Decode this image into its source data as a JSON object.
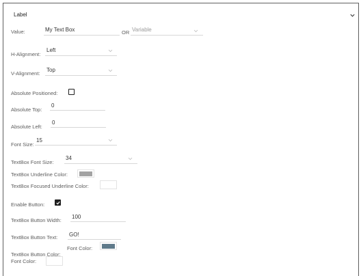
{
  "panel": {
    "title": "Label"
  },
  "value": {
    "label": "Value:",
    "text": "My Text Box",
    "or": "OR",
    "variable_placeholder": "Variable"
  },
  "h_alignment": {
    "label": "H-Alignment:",
    "value": "Left"
  },
  "v_alignment": {
    "label": "V-Alignment:",
    "value": "Top"
  },
  "absolute_positioned": {
    "label": "Absolute Positioned:",
    "checked": false
  },
  "absolute_top": {
    "label": "Absolute Top:",
    "value": "0"
  },
  "absolute_left": {
    "label": "Absolute Left:",
    "value": "0"
  },
  "font_size": {
    "label": "Font Size:",
    "value": "15"
  },
  "textbox_font_size": {
    "label": "TextBox Font Size:",
    "value": "34"
  },
  "textbox_underline_color": {
    "label": "TextBox Underline Color:",
    "color": "#a3a3a3"
  },
  "textbox_focused_underline_color": {
    "label": "TextBox Focused Underline Color:",
    "color": "#ffffff"
  },
  "enable_button": {
    "label": "Enable Button:",
    "checked": true
  },
  "textbox_button_width": {
    "label": "TextBox Button Width:",
    "value": "100"
  },
  "textbox_button_text": {
    "label": "TextBox Button Text:",
    "value": "GO!"
  },
  "button_font_color": {
    "label": "Font Color:",
    "color": "#5f7a8a"
  },
  "textbox_button_color": {
    "label_line1": "TextBox Button Color:",
    "label_line2": "Font Color:",
    "color": "#ffffff"
  }
}
